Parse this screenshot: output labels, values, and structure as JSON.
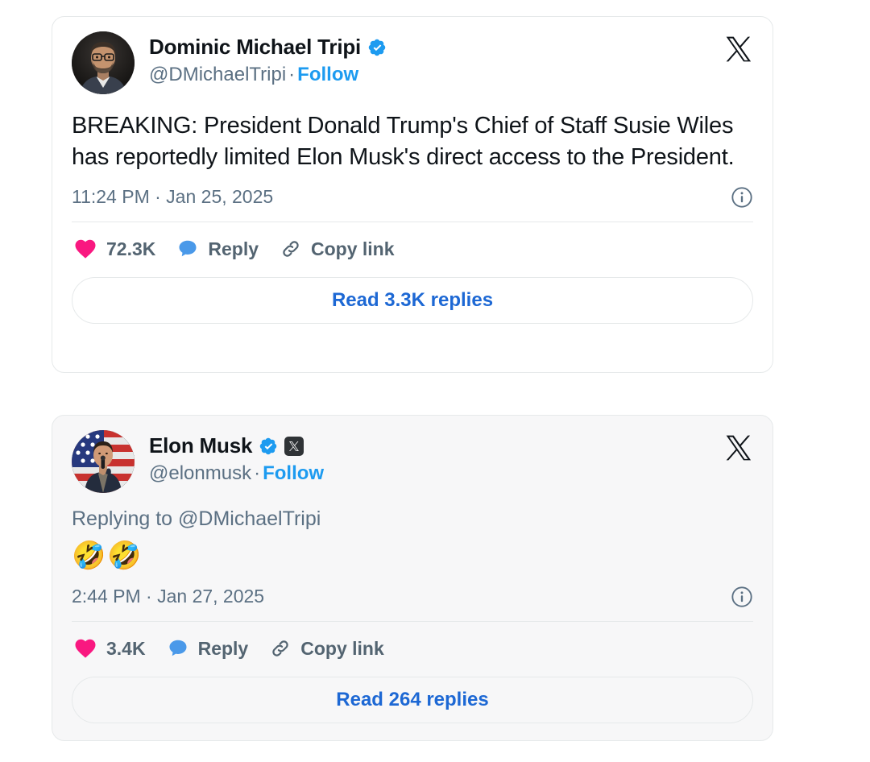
{
  "theme": {
    "page_background": "#ffffff",
    "card_background": "#ffffff",
    "card_background_tinted": "#f7f7f8",
    "card_border": "#e6e9ea",
    "text_primary": "#0f1419",
    "text_secondary": "#5b7083",
    "link_blue": "#1d9bf0",
    "read_replies_blue": "#1d68d4",
    "verified_blue": "#1d9bf0",
    "like_pink": "#f91880",
    "reply_blue": "#4a99e9",
    "action_gray": "#536471",
    "affiliate_badge_dark": "#2f3336"
  },
  "posts": [
    {
      "id": "post-dominic-tripi",
      "tinted": false,
      "author": {
        "display_name": "Dominic Michael Tripi",
        "handle": "@DMichaelTripi",
        "verified": true,
        "affiliate_badge": false,
        "avatar_alt": "photo of a bearded man wearing glasses and a dark blazer on a black background"
      },
      "follow_label": "Follow",
      "separator": "·",
      "reply_context": "",
      "body": "BREAKING: President Donald Trump's Chief of Staff Susie Wiles has reportedly limited Elon Musk's direct access to the President.",
      "emoji": "",
      "timestamp": "11:24 PM · Jan 25, 2025",
      "actions": {
        "like_count": "72.3K",
        "reply_label": "Reply",
        "copy_link_label": "Copy link"
      },
      "read_replies_label": "Read 3.3K replies",
      "icons": {
        "brand": "x-logo-icon",
        "info": "info-circle-icon",
        "like": "heart-icon",
        "reply": "speech-bubble-icon",
        "copy_link": "link-chain-icon"
      }
    },
    {
      "id": "post-elon-musk",
      "tinted": true,
      "author": {
        "display_name": "Elon Musk",
        "handle": "@elonmusk",
        "verified": true,
        "affiliate_badge": true,
        "avatar_alt": "photo of a man in a dark jacket holding a microphone in front of an American flag"
      },
      "follow_label": "Follow",
      "separator": "·",
      "reply_context": "Replying to @DMichaelTripi",
      "body": "",
      "emoji": "🤣🤣",
      "timestamp": "2:44 PM · Jan 27, 2025",
      "actions": {
        "like_count": "3.4K",
        "reply_label": "Reply",
        "copy_link_label": "Copy link"
      },
      "read_replies_label": "Read 264 replies",
      "icons": {
        "brand": "x-logo-icon",
        "info": "info-circle-icon",
        "like": "heart-icon",
        "reply": "speech-bubble-icon",
        "copy_link": "link-chain-icon"
      }
    }
  ]
}
